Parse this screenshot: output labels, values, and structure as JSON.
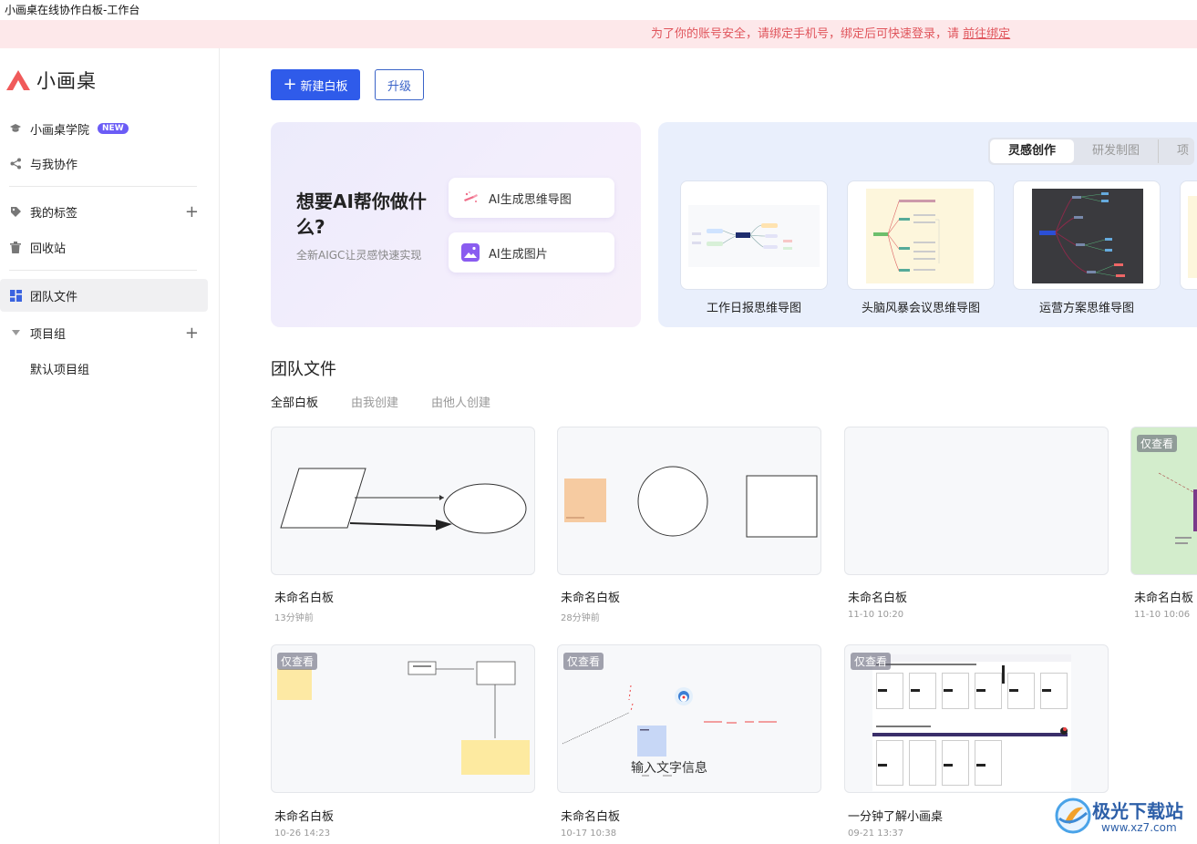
{
  "window": {
    "title": "小画桌在线协作白板-工作台"
  },
  "notice": {
    "text": "为了你的账号安全，请绑定手机号，绑定后可快速登录，请 ",
    "link": "前往绑定"
  },
  "sidebar": {
    "logo_text": "小画桌",
    "academy": {
      "label": "小画桌学院",
      "badge": "NEW"
    },
    "collab": "与我协作",
    "tags": "我的标签",
    "trash": "回收站",
    "team_files": "团队文件",
    "project_group": "项目组",
    "default_project": "默认项目组"
  },
  "toolbar": {
    "new_board": "新建白板",
    "upgrade": "升级"
  },
  "ai_card": {
    "title": "想要AI帮你做什么?",
    "subtitle": "全新AIGC让灵感快速实现",
    "mindmap_btn": "AI生成思维导图",
    "image_btn": "AI生成图片"
  },
  "templates": {
    "tabs": [
      "灵感创作",
      "研发制图",
      "项"
    ],
    "items": [
      {
        "label": "工作日报思维导图"
      },
      {
        "label": "头脑风暴会议思维导图"
      },
      {
        "label": "运营方案思维导图"
      }
    ]
  },
  "files": {
    "title": "团队文件",
    "tabs": [
      "全部白板",
      "由我创建",
      "由他人创建"
    ],
    "view_only": "仅查看",
    "boards": [
      {
        "name": "未命名白板",
        "time": "13分钟前"
      },
      {
        "name": "未命名白板",
        "time": "28分钟前"
      },
      {
        "name": "未命名白板",
        "time": "11-10 10:20"
      },
      {
        "name": "未命名白板",
        "time": "11-10 10:06"
      },
      {
        "name": "未命名白板",
        "time": "10-26 14:23"
      },
      {
        "name": "未命名白板",
        "time": "10-17 10:38"
      },
      {
        "name": "一分钟了解小画桌",
        "time": "09-21 13:37"
      }
    ],
    "board6_text": "输入文字信息"
  },
  "watermark": {
    "text": "极光下载站",
    "url": "www.xz7.com"
  },
  "colors": {
    "primary": "#2f5bea",
    "notice_bg": "#fde8ea",
    "notice_text": "#e0555c",
    "badge": "#6b5cf6"
  }
}
